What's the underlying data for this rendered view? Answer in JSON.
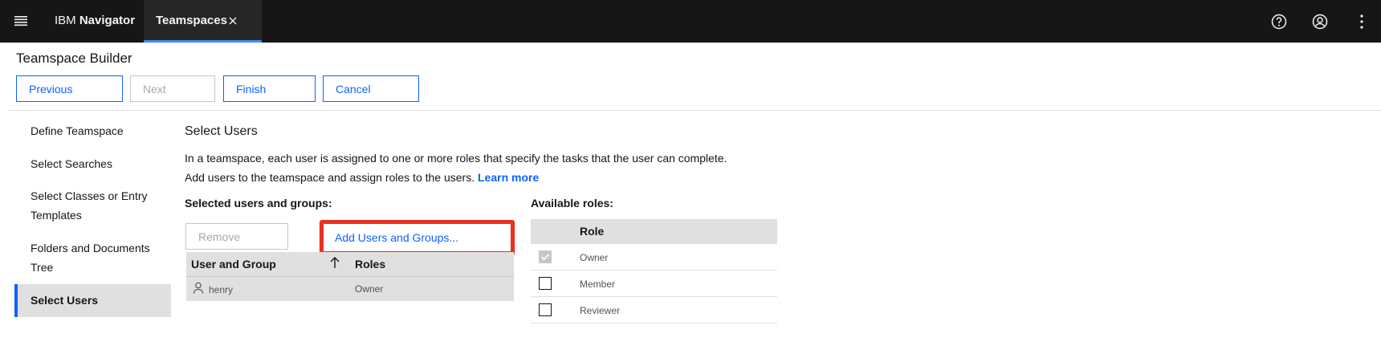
{
  "header": {
    "brand_prefix": "IBM",
    "brand_name": "Navigator",
    "tab_label": "Teamspaces",
    "icons": [
      "menu-icon",
      "close-icon",
      "help-icon",
      "user-avatar-icon",
      "overflow-menu-icon"
    ]
  },
  "builder": {
    "title": "Teamspace Builder",
    "buttons": {
      "previous": "Previous",
      "next": "Next",
      "finish": "Finish",
      "cancel": "Cancel"
    }
  },
  "nav": {
    "items": [
      {
        "label": "Define Teamspace"
      },
      {
        "label": "Select Searches"
      },
      {
        "label": "Select Classes or Entry Templates"
      },
      {
        "label": "Folders and Documents Tree"
      },
      {
        "label": "Select Users"
      }
    ],
    "active_index": 4
  },
  "main": {
    "title": "Select Users",
    "desc_line1": "In a teamspace, each user is assigned to one or more roles that specify the tasks that the user can complete.",
    "desc_line2": "Add users to the teamspace and assign roles to the users.",
    "learn_more": "Learn more",
    "selected_label": "Selected users and groups:",
    "remove_label": "Remove",
    "add_label": "Add Users and Groups...",
    "users_table": {
      "columns": [
        "User and Group",
        "Roles"
      ],
      "sort_icon": "arrow-up-icon",
      "rows": [
        {
          "name": "henry",
          "roles": "Owner",
          "icon": "user-icon"
        }
      ]
    },
    "roles_label": "Available roles:",
    "roles_table": {
      "column": "Role",
      "rows": [
        {
          "name": "Owner",
          "checked": true,
          "disabled": true
        },
        {
          "name": "Member",
          "checked": false,
          "disabled": false
        },
        {
          "name": "Reviewer",
          "checked": false,
          "disabled": false
        }
      ]
    }
  },
  "colors": {
    "topbar": "#161616",
    "accent": "#0f62fe",
    "highlight": "#e8321f"
  }
}
